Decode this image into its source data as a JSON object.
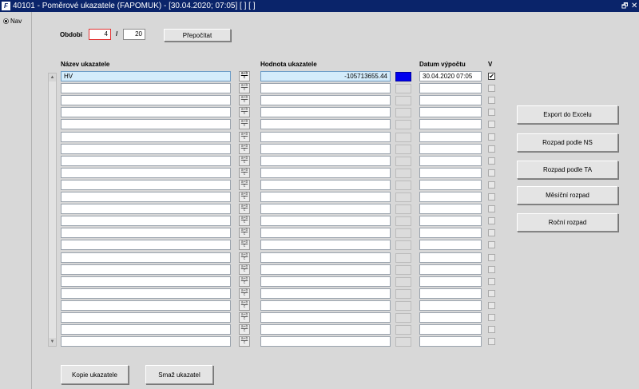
{
  "window": {
    "icon_label": "F",
    "title": "40101 - Poměrové ukazatele (FAPOMUK) - [30.04.2020; 07:05]  [ ]  [ ]",
    "restore_glyph": "🗗",
    "close_glyph": "✕"
  },
  "nav": {
    "label": "Nav"
  },
  "obdobi": {
    "label": "Období",
    "month": "4",
    "separator": "/",
    "year": "20"
  },
  "prepocitat_label": "Přepočítat",
  "headers": {
    "name": "Název ukazatele",
    "value": "Hodnota ukazatele",
    "date": "Datum výpočtu",
    "v": "V"
  },
  "row_button_label": "a+b\nc",
  "rows": [
    {
      "name": "HV",
      "value": "-105713655.44",
      "date": "30.04.2020 07:05",
      "checked": true,
      "color_on": true
    },
    {
      "name": "",
      "value": "",
      "date": "",
      "checked": false,
      "color_on": false
    },
    {
      "name": "",
      "value": "",
      "date": "",
      "checked": false,
      "color_on": false
    },
    {
      "name": "",
      "value": "",
      "date": "",
      "checked": false,
      "color_on": false
    },
    {
      "name": "",
      "value": "",
      "date": "",
      "checked": false,
      "color_on": false
    },
    {
      "name": "",
      "value": "",
      "date": "",
      "checked": false,
      "color_on": false
    },
    {
      "name": "",
      "value": "",
      "date": "",
      "checked": false,
      "color_on": false
    },
    {
      "name": "",
      "value": "",
      "date": "",
      "checked": false,
      "color_on": false
    },
    {
      "name": "",
      "value": "",
      "date": "",
      "checked": false,
      "color_on": false
    },
    {
      "name": "",
      "value": "",
      "date": "",
      "checked": false,
      "color_on": false
    },
    {
      "name": "",
      "value": "",
      "date": "",
      "checked": false,
      "color_on": false
    },
    {
      "name": "",
      "value": "",
      "date": "",
      "checked": false,
      "color_on": false
    },
    {
      "name": "",
      "value": "",
      "date": "",
      "checked": false,
      "color_on": false
    },
    {
      "name": "",
      "value": "",
      "date": "",
      "checked": false,
      "color_on": false
    },
    {
      "name": "",
      "value": "",
      "date": "",
      "checked": false,
      "color_on": false
    },
    {
      "name": "",
      "value": "",
      "date": "",
      "checked": false,
      "color_on": false
    },
    {
      "name": "",
      "value": "",
      "date": "",
      "checked": false,
      "color_on": false
    },
    {
      "name": "",
      "value": "",
      "date": "",
      "checked": false,
      "color_on": false
    },
    {
      "name": "",
      "value": "",
      "date": "",
      "checked": false,
      "color_on": false
    },
    {
      "name": "",
      "value": "",
      "date": "",
      "checked": false,
      "color_on": false
    },
    {
      "name": "",
      "value": "",
      "date": "",
      "checked": false,
      "color_on": false
    },
    {
      "name": "",
      "value": "",
      "date": "",
      "checked": false,
      "color_on": false
    },
    {
      "name": "",
      "value": "",
      "date": "",
      "checked": false,
      "color_on": false
    }
  ],
  "scrollbar": {
    "up": "▲",
    "down": "▼"
  },
  "side_buttons": [
    "Export do Excelu",
    "Rozpad podle NS",
    "Rozpad podle TA",
    "Měsíční rozpad",
    "Roční rozpad"
  ],
  "bottom_buttons": {
    "copy": "Kopie ukazatele",
    "delete": "Smaž ukazatel"
  },
  "colors": {
    "titlebar": "#0a246a",
    "selected_row": "#d4ecfb",
    "color_indicator": "#0000ee",
    "obdobi_border": "#e03030"
  }
}
